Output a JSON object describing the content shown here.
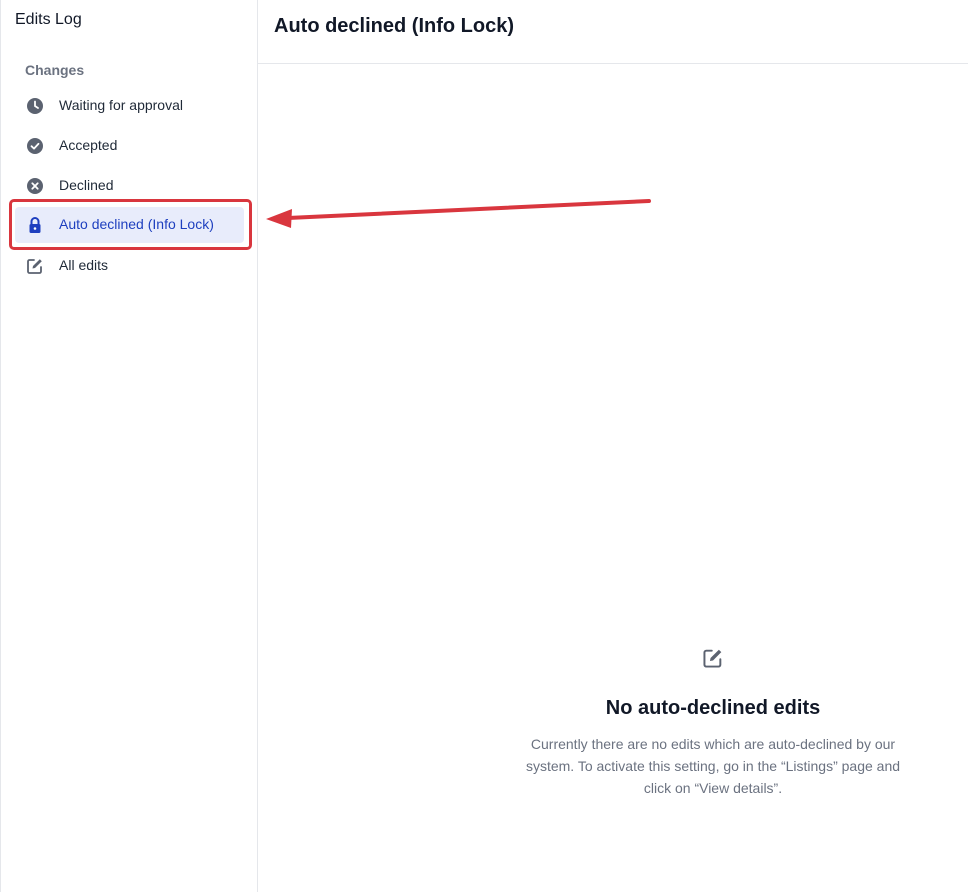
{
  "sidebar": {
    "title": "Edits Log",
    "section_label": "Changes",
    "items": [
      {
        "label": "Waiting for approval",
        "icon": "clock-icon"
      },
      {
        "label": "Accepted",
        "icon": "check-circle-icon"
      },
      {
        "label": "Declined",
        "icon": "x-circle-icon"
      },
      {
        "label": "Auto declined (Info Lock)",
        "icon": "lock-icon",
        "active": true
      },
      {
        "label": "All edits",
        "icon": "edit-icon"
      }
    ]
  },
  "main": {
    "title": "Auto declined (Info Lock)",
    "empty_state": {
      "icon": "edit-icon",
      "title": "No auto-declined edits",
      "text": "Currently there are no edits which are auto-declined by our system. To activate this setting, go in the “Listings” page and click on “View details”."
    }
  },
  "colors": {
    "active_bg": "#e8ecfb",
    "active_text": "#1e3fbf",
    "annotation": "#d9363e",
    "icon_gray": "#6b7280"
  }
}
